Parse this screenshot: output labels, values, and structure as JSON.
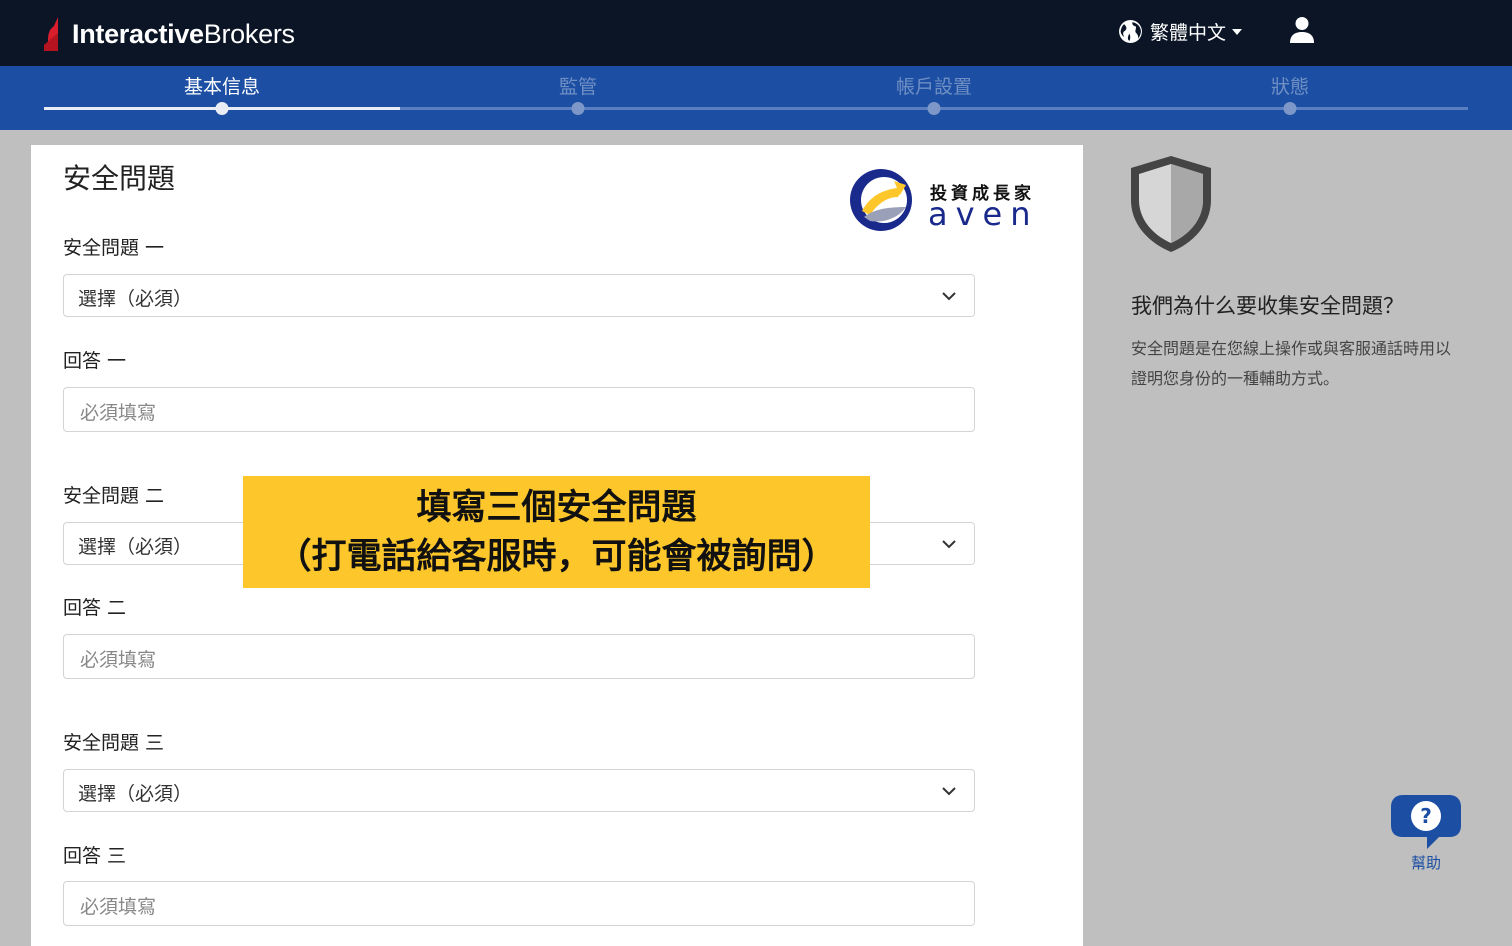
{
  "brand": {
    "logo_bold": "Interactive",
    "logo_regular": "Brokers"
  },
  "header": {
    "language": "繁體中文"
  },
  "steps": [
    {
      "label": "基本信息",
      "state": "active"
    },
    {
      "label": "監管",
      "state": "inactive"
    },
    {
      "label": "帳戶設置",
      "state": "inactive"
    },
    {
      "label": "狀態",
      "state": "inactive"
    }
  ],
  "form": {
    "title": "安全問題",
    "q1": {
      "question_label": "安全問題 一",
      "select_value": "選擇（必須）",
      "answer_label": "回答 一",
      "answer_placeholder": "必須填寫"
    },
    "q2": {
      "question_label": "安全問題 二",
      "select_value": "選擇（必須）",
      "answer_label": "回答 二",
      "answer_placeholder": "必須填寫"
    },
    "q3": {
      "question_label": "安全問題 三",
      "select_value": "選擇（必須）",
      "answer_label": "回答 三",
      "answer_placeholder": "必須填寫"
    }
  },
  "watermark": {
    "title": "投資成長家",
    "name": "aven"
  },
  "overlay": {
    "line1": "填寫三個安全問題",
    "line2": "（打電話給客服時，可能會被詢問）"
  },
  "sidebar": {
    "title": "我們為什么要收集安全問題？",
    "body": "安全問題是在您線上操作或與客服通話時用以證明您身份的一種輔助方式。"
  },
  "help": {
    "label": "幫助"
  },
  "colors": {
    "header_bg": "#0b1526",
    "stepbar_bg": "#1c4fa3",
    "banner_bg": "#fdc72c",
    "logo_red": "#d81e2c"
  }
}
